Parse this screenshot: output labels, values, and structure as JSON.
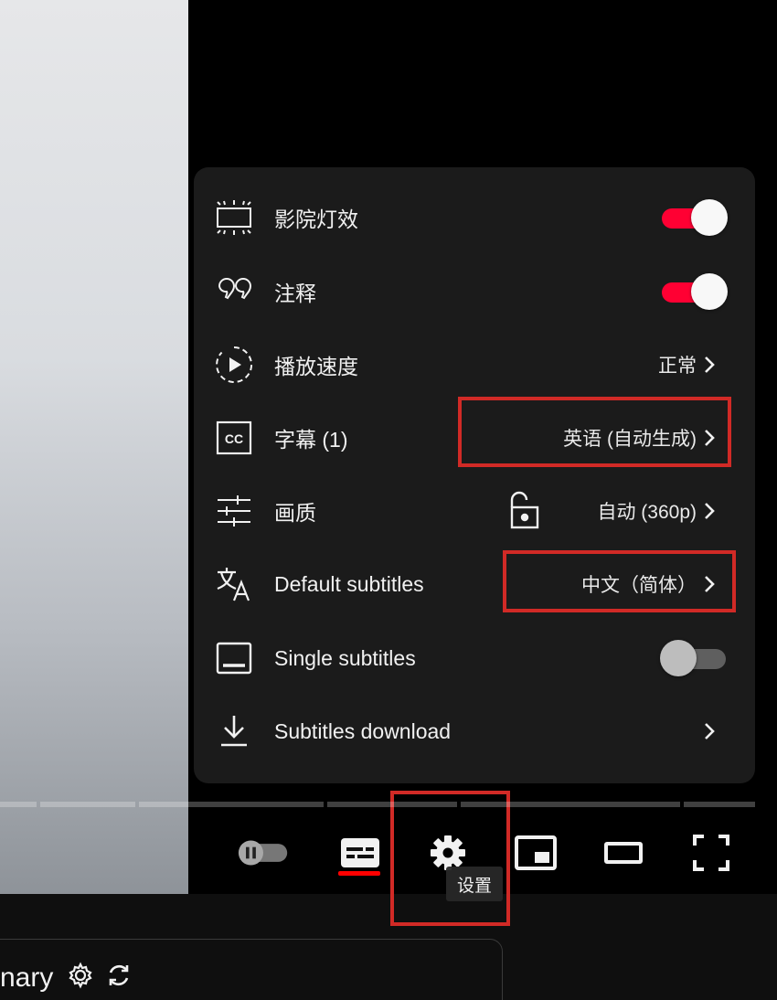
{
  "settings": {
    "rows": [
      {
        "label": "影院灯效",
        "icon": "ambient-mode-icon",
        "toggle": "on"
      },
      {
        "label": "注释",
        "icon": "annotations-icon",
        "toggle": "on"
      },
      {
        "label": "播放速度",
        "icon": "playback-speed-icon",
        "value": "正常"
      },
      {
        "label": "字幕 (1)",
        "icon": "subtitles-cc-icon",
        "value": "英语 (自动生成)"
      },
      {
        "label": "画质",
        "icon": "quality-sliders-icon",
        "value": "自动 (360p)"
      },
      {
        "label": "Default subtitles",
        "icon": "translate-icon",
        "value": "中文（简体）"
      },
      {
        "label": "Single subtitles",
        "icon": "single-subtitles-icon",
        "toggle": "off"
      },
      {
        "label": "Subtitles download",
        "icon": "download-icon"
      }
    ]
  },
  "controls": {
    "autoplay": "autoplay-toggle-icon",
    "subtitles": "subtitles-icon",
    "settings": "settings-gear-icon",
    "miniplayer": "miniplayer-icon",
    "theater": "theater-mode-icon",
    "fullscreen": "fullscreen-icon",
    "tooltip": "设置"
  },
  "summary": {
    "text": "nary"
  },
  "colors": {
    "accent": "#ff0033",
    "highlight_box": "#d12a26",
    "panel_bg": "#1c1c1c"
  }
}
